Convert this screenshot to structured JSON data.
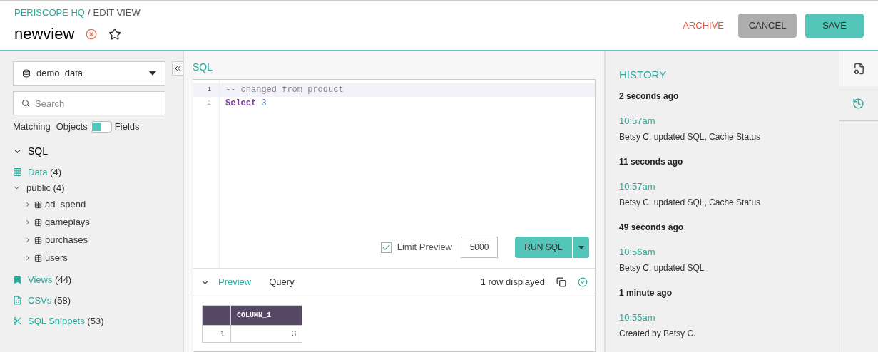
{
  "breadcrumb": {
    "org": "PERISCOPE HQ",
    "separator": "/",
    "page": "EDIT VIEW"
  },
  "title": "newview",
  "favorite": false,
  "actions": {
    "archive": "ARCHIVE",
    "cancel": "CANCEL",
    "save": "SAVE"
  },
  "sidebar": {
    "database": "demo_data",
    "search": {
      "placeholder": "Search"
    },
    "toggle": {
      "label": "Matching",
      "left": "Objects",
      "right": "Fields",
      "on": false
    },
    "section": {
      "label": "SQL",
      "expanded": true
    },
    "tree": [
      {
        "kind": "data",
        "label": "Data",
        "count": "(4)"
      },
      {
        "kind": "schema",
        "label": "public",
        "count": "(4)",
        "expanded": true,
        "children": [
          {
            "label": "ad_spend",
            "expanded": false
          },
          {
            "label": "gameplays",
            "expanded": false
          },
          {
            "label": "purchases",
            "expanded": false
          },
          {
            "label": "users",
            "expanded": false
          }
        ]
      },
      {
        "kind": "views",
        "label": "Views",
        "count": "(44)"
      },
      {
        "kind": "csvs",
        "label": "CSVs",
        "count": "(58)"
      },
      {
        "kind": "snippets",
        "label": "SQL Snippets",
        "count": "(53)"
      }
    ]
  },
  "editor": {
    "label": "SQL",
    "lines": [
      {
        "number": "1",
        "active": true,
        "tokens": [
          {
            "kind": "comment",
            "text": "-- changed from product"
          }
        ]
      },
      {
        "number": "2",
        "active": false,
        "tokens": [
          {
            "kind": "keyword",
            "text": "Select"
          },
          {
            "kind": "number",
            "text": "3"
          }
        ]
      }
    ],
    "limit_preview": {
      "label": "Limit Preview",
      "checked": true,
      "value": "5000"
    },
    "run": "RUN SQL"
  },
  "results": {
    "expanded": true,
    "tabs": [
      {
        "label": "Preview",
        "selected": true
      },
      {
        "label": "Query",
        "selected": false
      }
    ],
    "status": "1 row displayed",
    "success": true,
    "table": {
      "columns": [
        "COLUMN_1"
      ],
      "rows": [
        {
          "number": "1",
          "cells": [
            "3"
          ]
        }
      ]
    }
  },
  "history": {
    "title": "HISTORY",
    "entries": [
      {
        "ago": "2 seconds ago",
        "time": "10:57am",
        "text": "Betsy C. updated SQL, Cache Status"
      },
      {
        "ago": "11 seconds ago",
        "time": "10:57am",
        "text": "Betsy C. updated SQL, Cache Status"
      },
      {
        "ago": "49 seconds ago",
        "time": "10:56am",
        "text": "Betsy C. updated SQL"
      },
      {
        "ago": "1 minute ago",
        "time": "10:55am",
        "text": "Created by Betsy C."
      }
    ]
  },
  "side_tabs": [
    {
      "kind": "settings",
      "selected": false
    },
    {
      "kind": "history",
      "selected": true
    }
  ]
}
